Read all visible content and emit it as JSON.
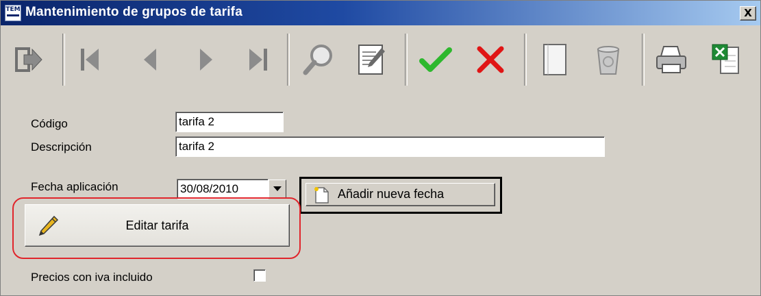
{
  "window": {
    "title": "Mantenimiento de grupos de tarifa",
    "close_label": "X",
    "app_icon_text": "TEM"
  },
  "toolbar": {
    "buttons": [
      {
        "name": "exit",
        "icon": "exit-arrow-icon"
      },
      {
        "name": "first",
        "icon": "first-record-icon"
      },
      {
        "name": "previous",
        "icon": "previous-record-icon"
      },
      {
        "name": "next",
        "icon": "next-record-icon"
      },
      {
        "name": "last",
        "icon": "last-record-icon"
      },
      {
        "name": "search",
        "icon": "magnifier-icon"
      },
      {
        "name": "edit",
        "icon": "edit-document-icon"
      },
      {
        "name": "accept",
        "icon": "checkmark-icon"
      },
      {
        "name": "cancel",
        "icon": "red-x-icon"
      },
      {
        "name": "new",
        "icon": "blank-page-icon"
      },
      {
        "name": "delete",
        "icon": "recycle-bin-icon"
      },
      {
        "name": "print",
        "icon": "printer-icon"
      },
      {
        "name": "excel",
        "icon": "excel-icon"
      }
    ],
    "colors": {
      "check": "#2eb82e",
      "cross": "#e01515",
      "excel": "#1e8a35"
    }
  },
  "form": {
    "codigo_label": "Código",
    "codigo_value": "tarifa 2",
    "descripcion_label": "Descripción",
    "descripcion_value": "tarifa 2",
    "fecha_label": "Fecha aplicación",
    "fecha_value": "30/08/2010",
    "add_date_label": "Añadir nueva fecha",
    "edit_tariff_label": "Editar tarifa",
    "iva_label": "Precios con iva incluido",
    "iva_checked": false
  },
  "highlight_color": "#e0252b"
}
